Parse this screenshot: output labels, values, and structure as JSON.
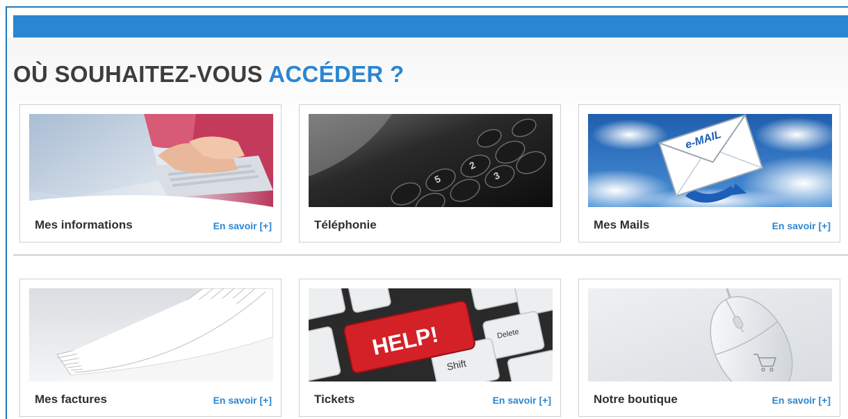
{
  "page": {
    "title_main": "OÙ SOUHAITEZ-VOUS",
    "title_accent": "ACCÉDER ?"
  },
  "colors": {
    "accent": "#2a86d2",
    "frame": "#1b78c0",
    "title": "#3d3d3d",
    "border": "#cfcfcf"
  },
  "cards": [
    {
      "title": "Mes informations",
      "link": "En savoir [+]",
      "icon": "laptop-typing-image"
    },
    {
      "title": "Téléphonie",
      "icon": "telephone-keypad-image"
    },
    {
      "title": "Mes Mails",
      "link": "En savoir [+]",
      "icon": "email-envelope-image",
      "image_text": "e-MAIL"
    },
    {
      "title": "Mes factures",
      "link": "En savoir [+]",
      "icon": "paper-stack-image"
    },
    {
      "title": "Tickets",
      "link": "En savoir [+]",
      "icon": "help-key-keyboard-image",
      "image_text": "HELP!",
      "image_keys": [
        "Shift",
        "Delete"
      ]
    },
    {
      "title": "Notre boutique",
      "link": "En savoir [+]",
      "icon": "shopping-mouse-image"
    }
  ]
}
